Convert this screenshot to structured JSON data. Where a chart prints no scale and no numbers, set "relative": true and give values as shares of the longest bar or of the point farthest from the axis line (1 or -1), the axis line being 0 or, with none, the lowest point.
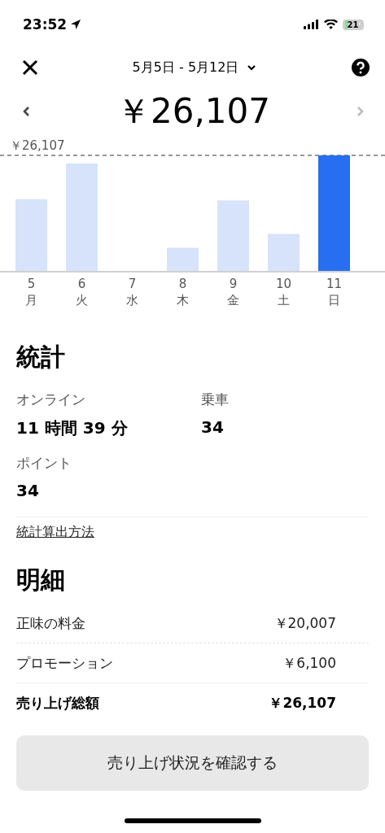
{
  "status_bar": {
    "time": "23:52",
    "battery": "21"
  },
  "header": {
    "date_range": "5月5日 - 5月12日"
  },
  "total": "￥26,107",
  "chart": {
    "chart_data": {
      "type": "bar",
      "categories": [
        "5",
        "6",
        "7",
        "8",
        "9",
        "10",
        "11"
      ],
      "values": [
        0.62,
        0.93,
        0,
        0.2,
        0.61,
        0.32,
        1
      ],
      "relative": true,
      "annotations": [
        "￥26,107"
      ]
    },
    "days": [
      {
        "weekday": "月",
        "selected": false
      },
      {
        "weekday": "火",
        "selected": false
      },
      {
        "weekday": "水",
        "selected": false
      },
      {
        "weekday": "木",
        "selected": false
      },
      {
        "weekday": "金",
        "selected": false
      },
      {
        "weekday": "土",
        "selected": false
      },
      {
        "weekday": "日",
        "selected": true
      }
    ]
  },
  "stats": {
    "title": "統計",
    "items": [
      {
        "label": "オンライン",
        "value": "11 時間 39 分"
      },
      {
        "label": "乗車",
        "value": "34"
      },
      {
        "label": "ポイント",
        "value": "34"
      }
    ],
    "link": "統計算出方法"
  },
  "breakdown": {
    "title": "明細",
    "rows": [
      {
        "label": "正味の料金",
        "amount": "￥20,007",
        "kind": "item"
      },
      {
        "label": "プロモーション",
        "amount": "￥6,100",
        "kind": "item"
      },
      {
        "label": "売り上げ総額",
        "amount": "￥26,107",
        "kind": "total"
      }
    ]
  },
  "button": "売り上げ状況を確認する"
}
